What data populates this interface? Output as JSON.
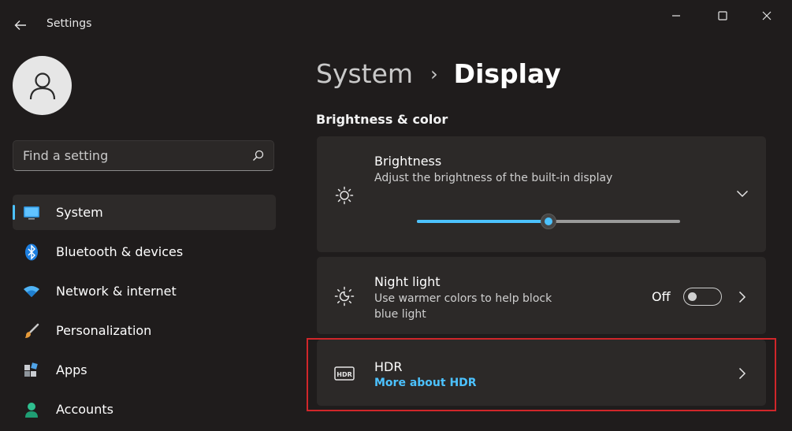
{
  "app": {
    "title": "Settings"
  },
  "window_controls": {
    "minimize": "minimize-icon",
    "maximize": "maximize-icon",
    "close": "close-icon"
  },
  "search": {
    "placeholder": "Find a setting"
  },
  "sidebar": {
    "items": [
      {
        "label": "System",
        "icon": "monitor-icon",
        "selected": true
      },
      {
        "label": "Bluetooth & devices",
        "icon": "bluetooth-icon",
        "selected": false
      },
      {
        "label": "Network & internet",
        "icon": "wifi-icon",
        "selected": false
      },
      {
        "label": "Personalization",
        "icon": "brush-icon",
        "selected": false
      },
      {
        "label": "Apps",
        "icon": "apps-icon",
        "selected": false
      },
      {
        "label": "Accounts",
        "icon": "person-icon",
        "selected": false
      }
    ]
  },
  "breadcrumb": {
    "parent": "System",
    "separator": "›",
    "current": "Display"
  },
  "section": {
    "title": "Brightness & color"
  },
  "brightness": {
    "title": "Brightness",
    "description": "Adjust the brightness of the built-in display",
    "value_percent": 50
  },
  "night_light": {
    "title": "Night light",
    "description_line1": "Use warmer colors to help block",
    "description_line2": "blue light",
    "state_label": "Off",
    "enabled": false
  },
  "hdr": {
    "title": "HDR",
    "link": "More about HDR"
  },
  "colors": {
    "accent": "#4cc2ff",
    "highlight": "#d0262a",
    "background": "#1f1c1c",
    "card": "#2c2928"
  }
}
